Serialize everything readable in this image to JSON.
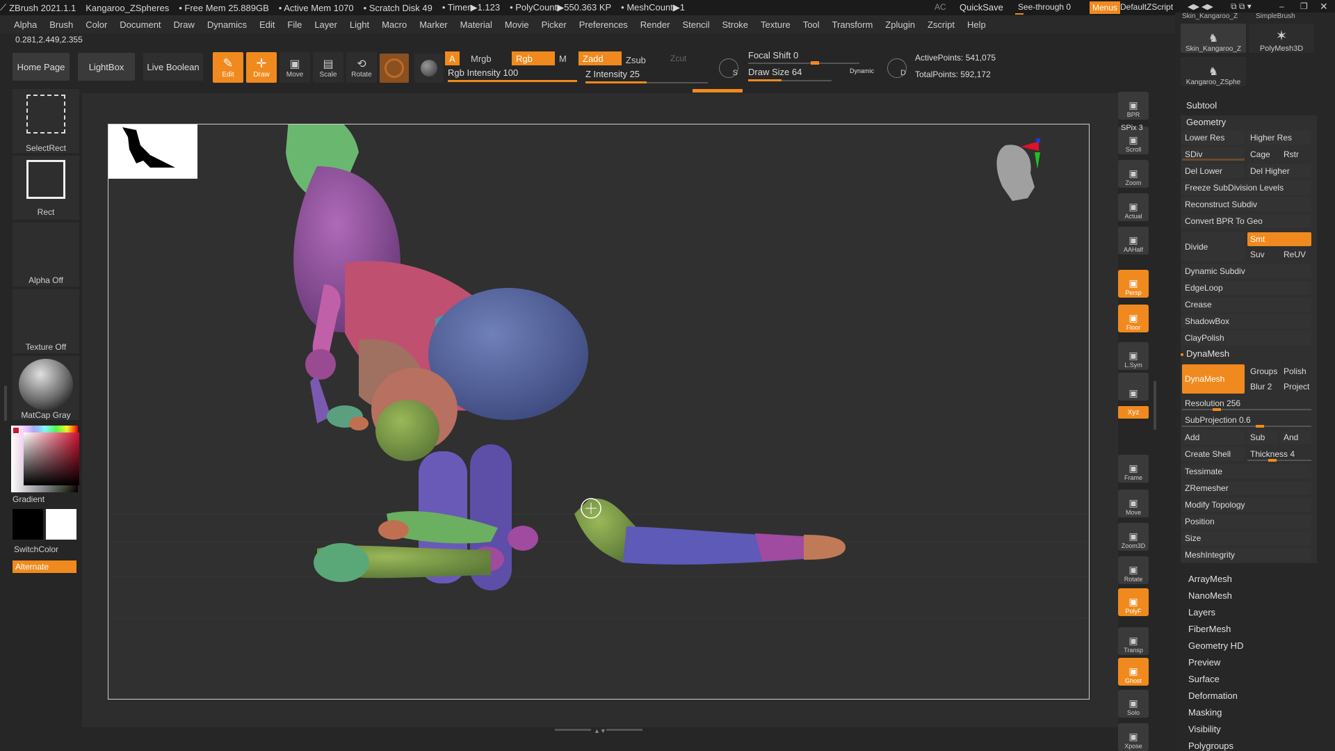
{
  "app": {
    "title": "ZBrush 2021.1.1",
    "document": "Kangaroo_ZSpheres",
    "free_mem": "• Free Mem 25.889GB",
    "active_mem": "• Active Mem 1070",
    "scratch_disk": "• Scratch Disk 49",
    "timer": "• Timer▶1.123",
    "polycount": "• PolyCount▶550.363 KP",
    "meshcount": "• MeshCount▶1",
    "ac": "AC",
    "quicksave": "QuickSave",
    "see_through": "See-through  0",
    "menus": "Menus",
    "default_script": "DefaultZScript"
  },
  "menu": [
    "Alpha",
    "Brush",
    "Color",
    "Document",
    "Draw",
    "Dynamics",
    "Edit",
    "File",
    "Layer",
    "Light",
    "Macro",
    "Marker",
    "Material",
    "Movie",
    "Picker",
    "Preferences",
    "Render",
    "Stencil",
    "Stroke",
    "Texture",
    "Tool",
    "Transform",
    "Zplugin",
    "Zscript",
    "Help"
  ],
  "coords": "0.281,2.449,2.355",
  "toolbar": {
    "home_page": "Home Page",
    "lightbox": "LightBox",
    "live_boolean": "Live Boolean",
    "edit": "Edit",
    "draw": "Draw",
    "move": "Move",
    "scale": "Scale",
    "rotate": "Rotate",
    "a": "A",
    "mrgb": "Mrgb",
    "rgb": "Rgb",
    "m": "M",
    "zadd": "Zadd",
    "zsub": "Zsub",
    "zcut": "Zcut",
    "rgb_intensity": "Rgb Intensity 100",
    "z_intensity": "Z Intensity 25",
    "focal_shift": "Focal Shift 0",
    "draw_size": "Draw Size 64",
    "dynamic": "Dynamic",
    "active_points": "ActivePoints: 541,075",
    "total_points": "TotalPoints: 592,172",
    "s": "S",
    "d": "D"
  },
  "left_shelf": {
    "select_rect": "SelectRect",
    "rect": "Rect",
    "alpha_off": "Alpha Off",
    "texture_off": "Texture Off",
    "matcap": "MatCap Gray",
    "gradient": "Gradient",
    "switch_color": "SwitchColor",
    "alternate": "Alternate"
  },
  "right_shelf": [
    {
      "label": "BPR",
      "on": false
    },
    {
      "label": "Scroll",
      "on": false
    },
    {
      "label": "Zoom",
      "on": false
    },
    {
      "label": "Actual",
      "on": false
    },
    {
      "label": "AAHalf",
      "on": false
    },
    {
      "label": "Persp",
      "on": true
    },
    {
      "label": "Floor",
      "on": true
    },
    {
      "label": "L.Sym",
      "on": false
    },
    {
      "label": "",
      "on": false
    },
    {
      "label": "Frame",
      "on": false
    },
    {
      "label": "Move",
      "on": false
    },
    {
      "label": "Zoom3D",
      "on": false
    },
    {
      "label": "Rotate",
      "on": false
    },
    {
      "label": "PolyF",
      "on": true
    },
    {
      "label": "Transp",
      "on": false
    },
    {
      "label": "Ghost",
      "on": true
    },
    {
      "label": "Solo",
      "on": false
    },
    {
      "label": "Xpose",
      "on": false
    }
  ],
  "spix": "SPix 3",
  "xyz": "Xyz",
  "tools": {
    "skin_top": "Skin_Kangaroo_Z",
    "simple_brush": "SimpleBrush",
    "skin": "Skin_Kangaroo_Z",
    "polymesh": "PolyMesh3D",
    "zsphere": "Kangaroo_ZSphe"
  },
  "panel": {
    "subtool": "Subtool",
    "geometry": "Geometry",
    "lower_res": "Lower Res",
    "higher_res": "Higher Res",
    "sdiv": "SDiv",
    "cage": "Cage",
    "rstr": "Rstr",
    "del_lower": "Del Lower",
    "del_higher": "Del Higher",
    "freeze": "Freeze SubDivision Levels",
    "reconstruct": "Reconstruct Subdiv",
    "convert_bpr": "Convert BPR To Geo",
    "divide": "Divide",
    "smt": "Smt",
    "suv": "Suv",
    "reuv": "ReUV",
    "dynamic_subdiv": "Dynamic Subdiv",
    "edgeloop": "EdgeLoop",
    "crease": "Crease",
    "shadowbox": "ShadowBox",
    "claypolish": "ClayPolish",
    "dynamesh_header": "DynaMesh",
    "dynamesh_btn": "DynaMesh",
    "groups": "Groups",
    "polish": "Polish",
    "blur": "Blur 2",
    "project": "Project",
    "resolution": "Resolution 256",
    "subprojection": "SubProjection 0.6",
    "add": "Add",
    "sub": "Sub",
    "and": "And",
    "create_shell": "Create Shell",
    "thickness": "Thickness 4",
    "tessimate": "Tessimate",
    "zremesher": "ZRemesher",
    "modify_topology": "Modify Topology",
    "position": "Position",
    "size": "Size",
    "meshintegrity": "MeshIntegrity",
    "sections": [
      "ArrayMesh",
      "NanoMesh",
      "Layers",
      "FiberMesh",
      "Geometry HD",
      "Preview",
      "Surface",
      "Deformation",
      "Masking",
      "Visibility",
      "Polygroups"
    ]
  }
}
